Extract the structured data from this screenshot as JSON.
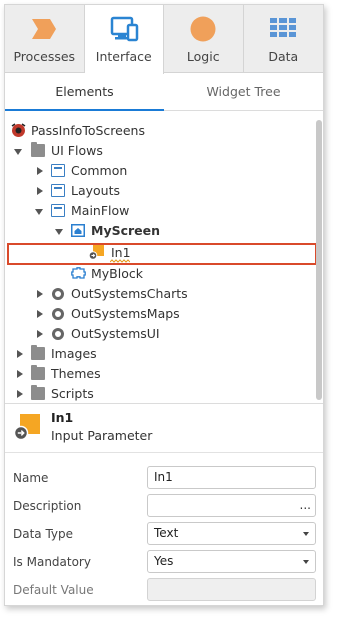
{
  "top_tabs": [
    {
      "label": "Processes",
      "icon": "processes-icon",
      "color": "#f0a05a"
    },
    {
      "label": "Interface",
      "icon": "interface-icon",
      "color": "#2a84d2"
    },
    {
      "label": "Logic",
      "icon": "logic-icon",
      "color": "#f0a05a"
    },
    {
      "label": "Data",
      "icon": "data-icon",
      "color": "#5a95d6"
    }
  ],
  "active_top_tab": "Interface",
  "sub_tabs": [
    {
      "label": "Elements"
    },
    {
      "label": "Widget Tree"
    }
  ],
  "active_sub_tab": "Elements",
  "tree": {
    "root": "PassInfoToScreens",
    "ui_flows": "UI Flows",
    "common": "Common",
    "layouts": "Layouts",
    "mainflow": "MainFlow",
    "myscreen": "MyScreen",
    "in1": "In1",
    "myblock": "MyBlock",
    "outsystemscharts": "OutSystemsCharts",
    "outsystemsmaps": "OutSystemsMaps",
    "outsystemsui": "OutSystemsUI",
    "images": "Images",
    "themes": "Themes",
    "scripts": "Scripts"
  },
  "selected_item": "In1",
  "details": {
    "title": "In1",
    "subtitle": "Input Parameter",
    "icon": "input-parameter-icon",
    "properties": {
      "name": {
        "label": "Name",
        "value": "In1"
      },
      "description": {
        "label": "Description",
        "value": "",
        "button": "..."
      },
      "data_type": {
        "label": "Data Type",
        "value": "Text"
      },
      "is_mandatory": {
        "label": "Is Mandatory",
        "value": "Yes"
      },
      "default_value": {
        "label": "Default Value",
        "value": ""
      }
    }
  },
  "colors": {
    "accent": "#1a7bd6",
    "selection_border": "#d94a2b",
    "parameter_orange": "#f5a623"
  }
}
